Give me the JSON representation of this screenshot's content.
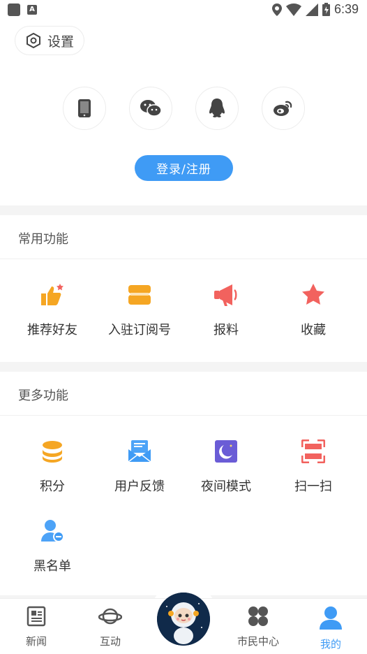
{
  "status_bar": {
    "time": "6:39"
  },
  "settings": {
    "label": "设置"
  },
  "login": {
    "social_icons": [
      "phone-icon",
      "wechat-icon",
      "qq-icon",
      "weibo-icon"
    ],
    "button_label": "登录/注册"
  },
  "common": {
    "title": "常用功能",
    "items": [
      {
        "label": "推荐好友",
        "icon": "thumbs-up-icon"
      },
      {
        "label": "入驻订阅号",
        "icon": "subscribe-icon"
      },
      {
        "label": "报料",
        "icon": "megaphone-icon"
      },
      {
        "label": "收藏",
        "icon": "star-icon"
      }
    ]
  },
  "more": {
    "title": "更多功能",
    "items": [
      {
        "label": "积分",
        "icon": "coins-icon"
      },
      {
        "label": "用户反馈",
        "icon": "feedback-mail-icon"
      },
      {
        "label": "夜间模式",
        "icon": "night-moon-icon"
      },
      {
        "label": "扫一扫",
        "icon": "scan-icon"
      },
      {
        "label": "黑名单",
        "icon": "blacklist-user-icon"
      }
    ]
  },
  "nav": {
    "items": [
      {
        "label": "新闻",
        "icon": "news-icon"
      },
      {
        "label": "互动",
        "icon": "planet-icon"
      },
      {
        "label": "",
        "icon": "astronaut-icon"
      },
      {
        "label": "市民中心",
        "icon": "clover-icon"
      },
      {
        "label": "我的",
        "icon": "user-icon"
      }
    ],
    "active": "我的"
  },
  "colors": {
    "accent": "#3f9bf5",
    "orange": "#f5a623",
    "red": "#f2625e",
    "purple": "#6a5cd6"
  }
}
